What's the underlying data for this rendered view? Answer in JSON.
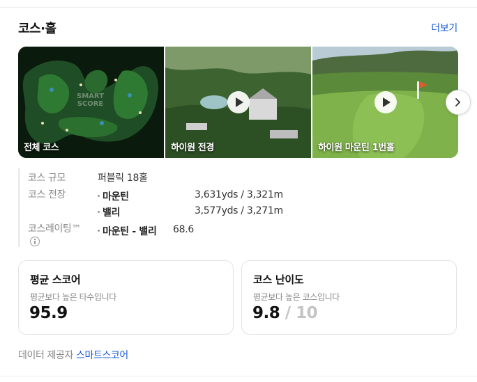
{
  "header": {
    "title": "코스·홀",
    "more_label": "더보기"
  },
  "gallery": {
    "items": [
      {
        "caption": "전체 코스",
        "watermark": "SMART\nSCORE",
        "has_play": false
      },
      {
        "caption": "하이원 전경",
        "has_play": true
      },
      {
        "caption": "하이원 마운틴 1번홀",
        "has_play": true
      }
    ],
    "next_icon": "chevron-right-icon"
  },
  "info": {
    "scale_label": "코스 규모",
    "scale_value": "퍼블릭 18홀",
    "length_label": "코스 전장",
    "lengths": [
      {
        "name": "마운틴",
        "value": "3,631yds / 3,321m"
      },
      {
        "name": "밸리",
        "value": "3,577yds / 3,271m"
      }
    ],
    "rating_label": "코스레이팅™",
    "rating_icon": "info-icon",
    "rating_name": "마운틴 - 밸리",
    "rating_value": "68.6"
  },
  "stats": {
    "avg": {
      "title": "평균 스코어",
      "sub": "평균보다 높은 타수입니다",
      "value": "95.9"
    },
    "difficulty": {
      "title": "코스 난이도",
      "sub": "평균보다 높은 코스입니다",
      "value": "9.8",
      "max": " / 10"
    }
  },
  "provider": {
    "label": "데이터 제공자",
    "link": "스마트스코어"
  },
  "colors": {
    "link": "#1a5bd6",
    "muted": "#888888",
    "text": "#111111"
  }
}
